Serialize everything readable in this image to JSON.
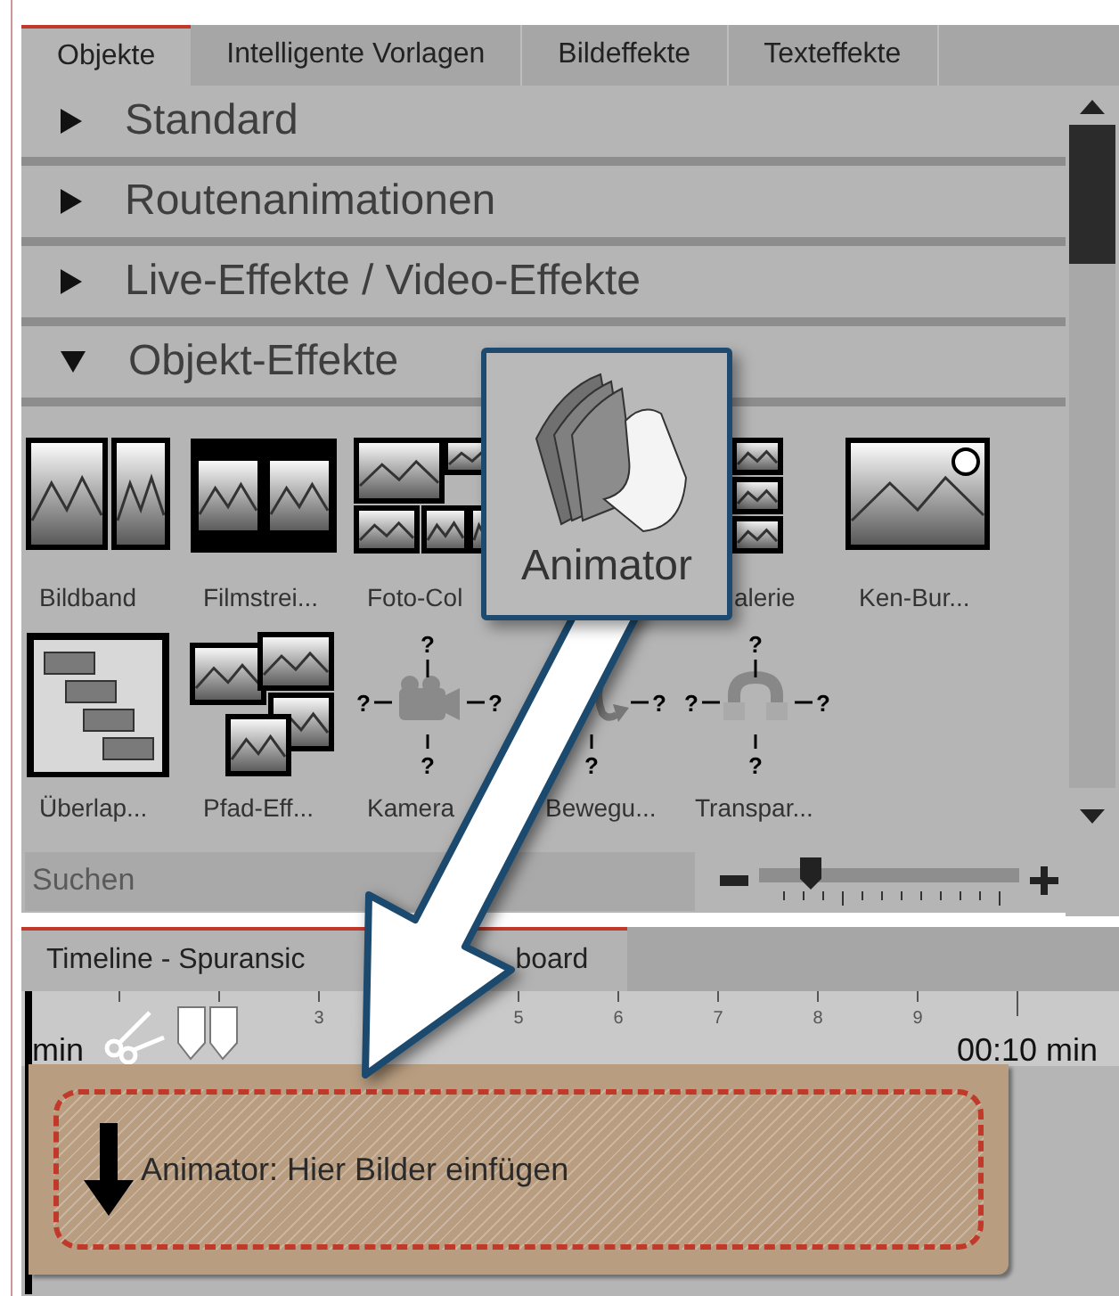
{
  "tabs": [
    {
      "label": "Objekte",
      "selected": true
    },
    {
      "label": "Intelligente Vorlagen",
      "selected": false
    },
    {
      "label": "Bildeffekte",
      "selected": false
    },
    {
      "label": "Texteffekte",
      "selected": false
    }
  ],
  "sections": [
    {
      "label": "Standard",
      "expanded": false
    },
    {
      "label": "Routenanimationen",
      "expanded": false
    },
    {
      "label": "Live-Effekte / Video-Effekte",
      "expanded": false
    },
    {
      "label": "Objekt-Effekte",
      "expanded": true
    }
  ],
  "effects": [
    [
      {
        "kind": "bildband",
        "label": "Bildband"
      },
      {
        "kind": "filmstreifen",
        "label": "Filmstrei..."
      },
      {
        "kind": "collage",
        "label": "Foto-Col"
      },
      {
        "kind": "galerie",
        "label": "alerie"
      },
      {
        "kind": "kenburns",
        "label": "Ken-Bur..."
      }
    ],
    [
      {
        "kind": "ueberlappung",
        "label": "Überlap..."
      },
      {
        "kind": "pfad",
        "label": "Pfad-Eff..."
      },
      {
        "kind": "kamera",
        "label": "Kamera",
        "markers": [
          "?",
          "?",
          "?",
          "?"
        ]
      },
      {
        "kind": "bewegung",
        "label": "Bewegu...",
        "markers": [
          "?",
          "?"
        ]
      },
      {
        "kind": "transparenz",
        "label": "Transpar...",
        "markers": [
          "?",
          "?",
          "?",
          "?"
        ]
      }
    ]
  ],
  "search": {
    "placeholder": "Suchen"
  },
  "zoom_slider": {
    "level": 0.2
  },
  "tooltip": {
    "label": "Animator"
  },
  "timeline": {
    "tab_texts": [
      "Timeline - Spuransic",
      "board"
    ],
    "start_label": "min",
    "tick_labels": [
      "3",
      "5",
      "6",
      "7",
      "8",
      "9"
    ],
    "end_label": "00:10 min",
    "clip": {
      "label": "Animator: Hier Bilder einfügen"
    }
  }
}
